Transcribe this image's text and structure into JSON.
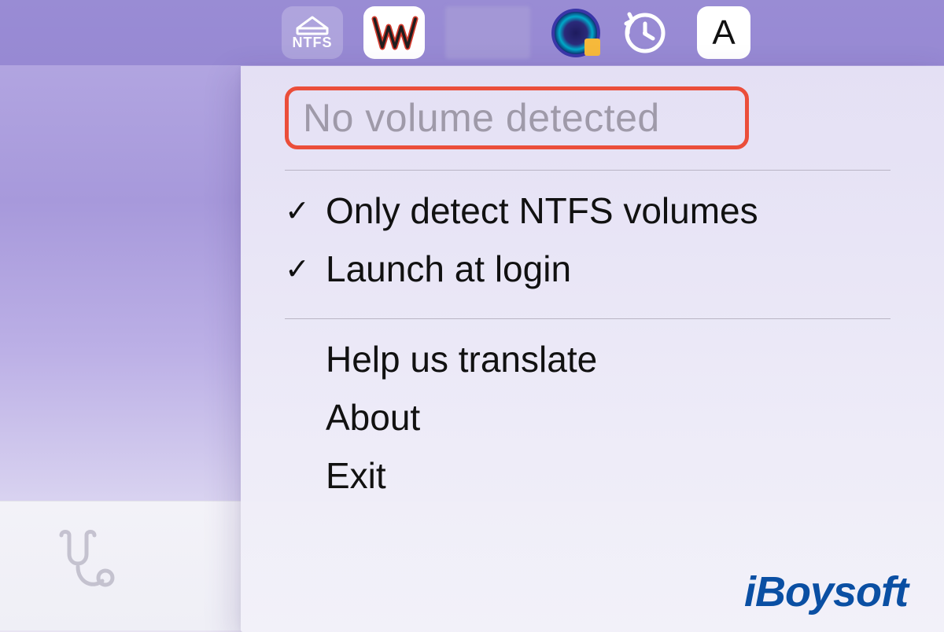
{
  "menubar": {
    "ntfs_label": "NTFS",
    "a_label": "A"
  },
  "dropdown": {
    "status": "No volume detected",
    "items": [
      {
        "label": "Only detect NTFS volumes",
        "checked": true
      },
      {
        "label": "Launch at login",
        "checked": true
      },
      {
        "label": "Help us translate",
        "checked": false
      },
      {
        "label": "About",
        "checked": false
      },
      {
        "label": "Exit",
        "checked": false
      }
    ]
  },
  "watermark": "iBoysoft"
}
